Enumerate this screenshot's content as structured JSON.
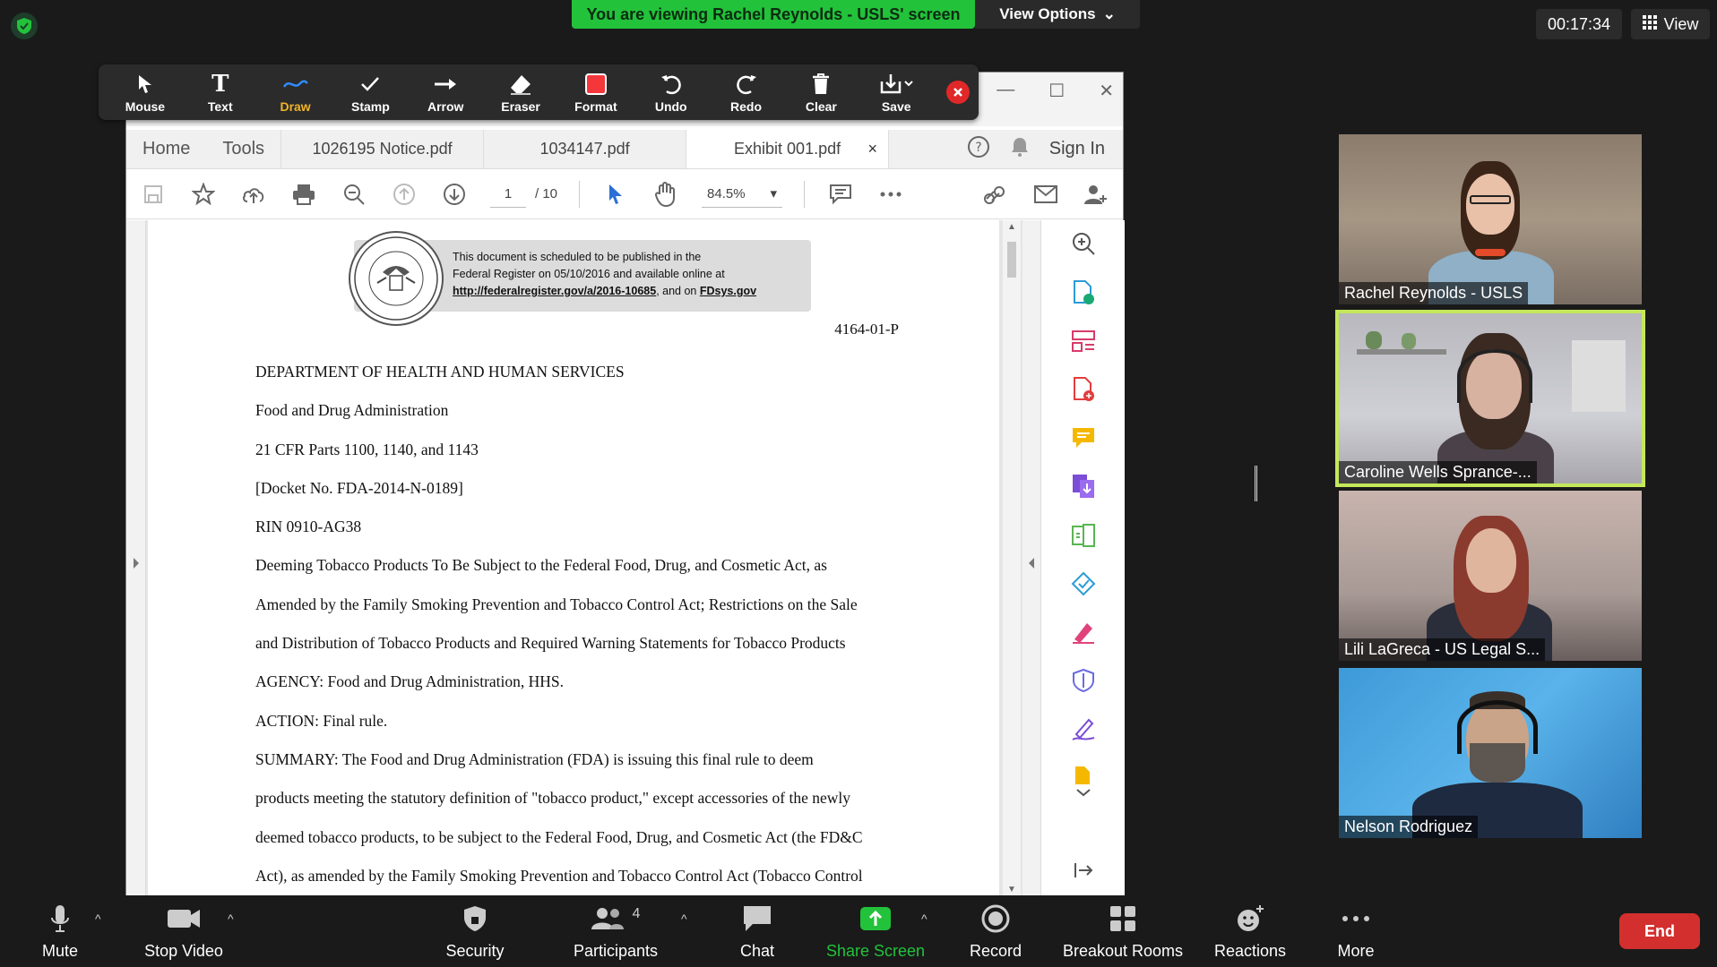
{
  "banner": {
    "viewing": "You are viewing Rachel Reynolds - USLS' screen",
    "view_options": "View Options"
  },
  "timer": "00:17:34",
  "view_label": "View",
  "annotation_toolbar": {
    "items": [
      {
        "label": "Mouse",
        "icon": "cursor-icon"
      },
      {
        "label": "Text",
        "icon": "text-icon"
      },
      {
        "label": "Draw",
        "icon": "draw-icon"
      },
      {
        "label": "Stamp",
        "icon": "stamp-icon"
      },
      {
        "label": "Arrow",
        "icon": "arrow-icon"
      },
      {
        "label": "Eraser",
        "icon": "eraser-icon"
      },
      {
        "label": "Format",
        "icon": "format-icon"
      },
      {
        "label": "Undo",
        "icon": "undo-icon"
      },
      {
        "label": "Redo",
        "icon": "redo-icon"
      },
      {
        "label": "Clear",
        "icon": "trash-icon"
      },
      {
        "label": "Save",
        "icon": "save-icon"
      }
    ],
    "active": "Draw"
  },
  "acrobat": {
    "nav": [
      "Home",
      "Tools"
    ],
    "tabs": [
      "1026195 Notice.pdf",
      "1034147.pdf",
      "Exhibit 001.pdf"
    ],
    "active_tab": "Exhibit 001.pdf",
    "sign_in": "Sign In",
    "page_current": "1",
    "page_total": "/ 10",
    "zoom": "84.5%"
  },
  "document": {
    "fr_line1": "This document is scheduled to be published in the",
    "fr_line2": "Federal Register on 05/10/2016 and available online at",
    "fr_link": "http://federalregister.gov/a/2016-10685",
    "fr_and": ", and on ",
    "fr_fdsys": "FDsys.gov",
    "code": "4164-01-P",
    "lines": [
      "DEPARTMENT OF HEALTH AND HUMAN SERVICES",
      "Food and Drug Administration",
      "21 CFR Parts 1100, 1140, and 1143",
      "[Docket No. FDA-2014-N-0189]",
      "RIN 0910-AG38",
      "Deeming Tobacco Products To Be Subject to the Federal Food, Drug, and Cosmetic Act, as",
      "Amended by the Family Smoking Prevention and Tobacco Control Act; Restrictions on the Sale",
      "and Distribution of Tobacco Products and Required Warning Statements for Tobacco Products",
      "AGENCY:  Food and Drug Administration, HHS.",
      "ACTION:  Final rule.",
      "SUMMARY:  The Food and Drug Administration (FDA) is issuing this final rule to deem",
      "products meeting the statutory definition of \"tobacco product,\" except accessories of the newly",
      "deemed tobacco products, to be subject to the Federal Food, Drug, and Cosmetic Act (the FD&C",
      "Act), as amended by the Family Smoking Prevention and Tobacco Control Act (Tobacco Control"
    ]
  },
  "participants": [
    {
      "name": "Rachel Reynolds - USLS"
    },
    {
      "name": "Caroline Wells Sprance-..."
    },
    {
      "name": "Lili LaGreca - US Legal S..."
    },
    {
      "name": "Nelson Rodriguez"
    }
  ],
  "bottom_bar": {
    "mute": "Mute",
    "stop_video": "Stop Video",
    "security": "Security",
    "participants": "Participants",
    "participants_count": "4",
    "chat": "Chat",
    "share_screen": "Share Screen",
    "record": "Record",
    "breakout": "Breakout Rooms",
    "reactions": "Reactions",
    "more": "More",
    "end": "End"
  },
  "colors": {
    "banner_green": "#23c23b",
    "speaking_outline": "#c4e85b",
    "end_red": "#d32f2f",
    "draw_active": "#f0b429"
  }
}
